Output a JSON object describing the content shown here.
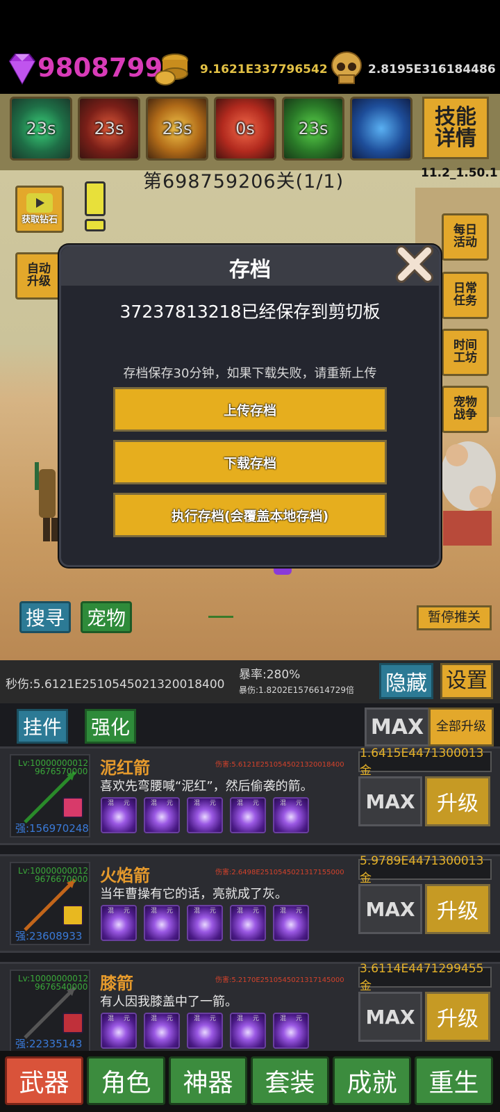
{
  "resources": {
    "diamonds": "9808799",
    "gold": "9.1621E337796542",
    "skulls": "2.8195E316184486"
  },
  "skills": {
    "cooldowns": [
      "23s",
      "23s",
      "23s",
      "0s",
      "23s",
      ""
    ],
    "detail_label_line1": "技能",
    "detail_label_line2": "详情"
  },
  "stage": {
    "label": "第698759206关(1/1)",
    "version": "11.2_1.50.1"
  },
  "scene": {
    "get_diamond_label": "获取钻石",
    "auto_upgrade_line1": "自动",
    "auto_upgrade_line2": "升级",
    "side_buttons": [
      {
        "l1": "每日",
        "l2": "活动"
      },
      {
        "l1": "日常",
        "l2": "任务"
      },
      {
        "l1": "时间",
        "l2": "工坊"
      },
      {
        "l1": "宠物",
        "l2": "战争"
      }
    ],
    "search_label": "搜寻",
    "pet_label": "宠物",
    "pause_label": "暂停推关"
  },
  "dialog": {
    "title": "存档",
    "message": "37237813218已经保存到剪切板",
    "note": "存档保存30分钟，如果下载失败，请重新上传",
    "upload_label": "上传存档",
    "download_label": "下载存档",
    "execute_label": "执行存档(会覆盖本地存档)"
  },
  "stats": {
    "dps": "秒伤:5.6121E2510545021320018400",
    "crit_rate": "暴率:280%",
    "crit_dmg": "暴伤:1.8202E1576614729倍",
    "hide_label": "隐藏",
    "settings_label": "设置"
  },
  "panel": {
    "hangup_label": "挂件",
    "enhance_label": "强化",
    "max_label": "MAX",
    "upgrade_all_label": "全部升级"
  },
  "weapons": [
    {
      "level": "Lv:10000000012",
      "sub": "9676570000",
      "strength": "强:156970248",
      "name": "泥红箭",
      "damage": "伤害:5.6121E2510545021320018400",
      "desc": "喜欢先弯腰喊“泥红”，然后偷袭的箭。",
      "cost": "1.6415E4471300013金",
      "max": "MAX",
      "upgrade": "升级",
      "gem_color": "#d83a6a"
    },
    {
      "level": "Lv:10000000012",
      "sub": "9676670000",
      "strength": "强:23608933",
      "name": "火焰箭",
      "damage": "伤害:2.6498E2510545021317155000",
      "desc": "当年曹操有它的话，亮就成了灰。",
      "cost": "5.9789E4471300013金",
      "max": "MAX",
      "upgrade": "升级",
      "gem_color": "#e8b820"
    },
    {
      "level": "Lv:10000000012",
      "sub": "9676540000",
      "strength": "强:22335143",
      "name": "膝箭",
      "damage": "伤害:5.2170E2510545021317145000",
      "desc": "有人因我膝盖中了一箭。",
      "cost": "3.6114E4471299455金",
      "max": "MAX",
      "upgrade": "升级",
      "gem_color": "#c0303a"
    }
  ],
  "gem_labels": [
    "混",
    "元"
  ],
  "nav": [
    "武器",
    "角色",
    "神器",
    "套装",
    "成就",
    "重生"
  ]
}
